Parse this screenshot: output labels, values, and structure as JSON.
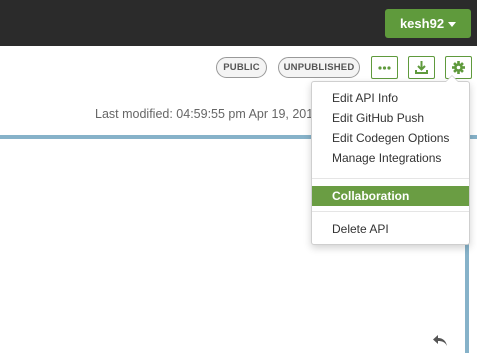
{
  "header": {
    "user_label": "kesh92"
  },
  "badges": {
    "public": "PUBLIC",
    "unpublished": "UNPUBLISHED"
  },
  "toolbar": {
    "more_icon": "ellipsis-icon",
    "download_icon": "download-icon",
    "settings_icon": "gear-icon"
  },
  "main": {
    "last_modified": "Last modified: 04:59:55 pm Apr 19, 201"
  },
  "menu": {
    "items": [
      {
        "label": "Edit API Info"
      },
      {
        "label": "Edit GitHub Push"
      },
      {
        "label": "Edit Codegen Options"
      },
      {
        "label": "Manage Integrations"
      },
      {
        "label": "Collaboration",
        "active": true
      },
      {
        "label": "Delete API"
      }
    ]
  },
  "colors": {
    "accent": "#5f9a3c",
    "active_item": "#6a9d43",
    "topbar": "#2b2b2b",
    "panel_border": "#86b2c9"
  }
}
